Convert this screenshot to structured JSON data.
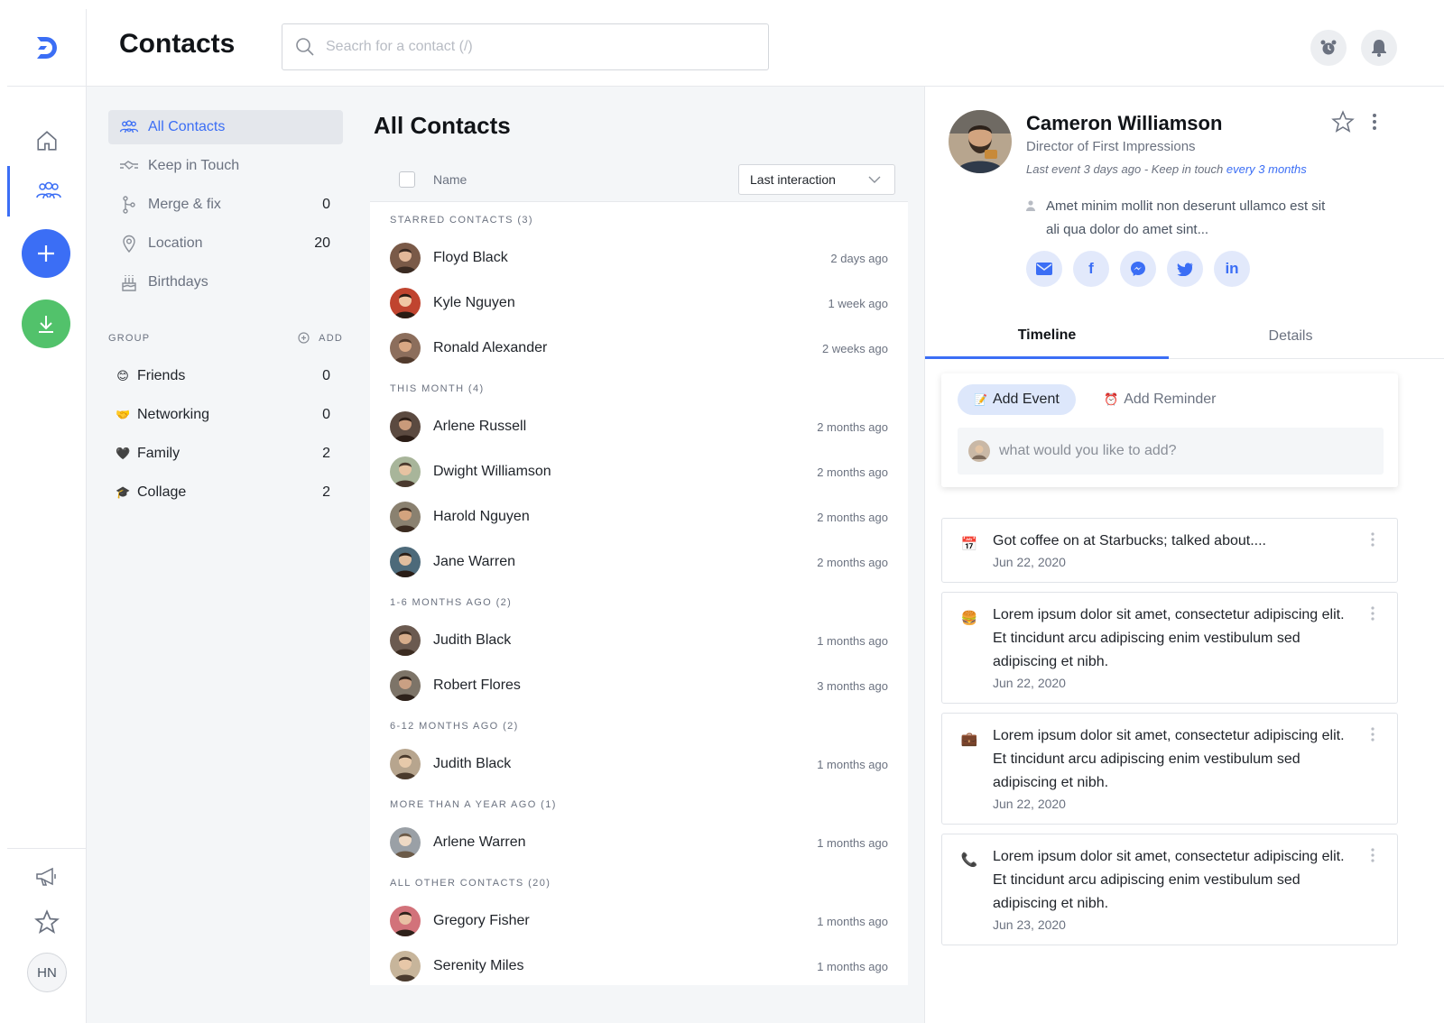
{
  "app": {
    "page_title": "Contacts",
    "brand_color": "#3b6ef5"
  },
  "search": {
    "placeholder": "Seacrh for a contact (/)"
  },
  "rail": {
    "user_initials": "HN"
  },
  "filters": [
    {
      "label": "All Contacts",
      "count": "",
      "icon": "people-icon"
    },
    {
      "label": "Keep in Touch",
      "count": "",
      "icon": "handshake-icon"
    },
    {
      "label": "Merge & fix",
      "count": "0",
      "icon": "merge-icon"
    },
    {
      "label": "Location",
      "count": "20",
      "icon": "location-pin-icon"
    },
    {
      "label": "Birthdays",
      "count": "",
      "icon": "cake-icon"
    }
  ],
  "groups": {
    "header": "GROUP",
    "add_label": "ADD",
    "items": [
      {
        "emoji": "😊",
        "label": "Friends",
        "count": "0"
      },
      {
        "emoji": "🤝",
        "label": "Networking",
        "count": "0"
      },
      {
        "emoji": "🖤",
        "label": "Family",
        "count": "2"
      },
      {
        "emoji": "🎓",
        "label": "Collage",
        "count": "2"
      }
    ]
  },
  "list": {
    "title": "All Contacts",
    "name_header": "Name",
    "sort_label": "Last interaction",
    "sections": [
      {
        "label": "STARRED CONTACTS (3)",
        "rows": [
          {
            "name": "Floyd Black",
            "time": "2 days ago"
          },
          {
            "name": "Kyle Nguyen",
            "time": "1 week ago"
          },
          {
            "name": "Ronald Alexander",
            "time": "2 weeks ago"
          }
        ]
      },
      {
        "label": "THIS MONTH (4)",
        "rows": [
          {
            "name": "Arlene Russell",
            "time": "2 months ago"
          },
          {
            "name": "Dwight Williamson",
            "time": "2 months ago"
          },
          {
            "name": "Harold Nguyen",
            "time": "2 months ago"
          },
          {
            "name": "Jane Warren",
            "time": "2 months ago"
          }
        ]
      },
      {
        "label": "1-6 MONTHS AGO (2)",
        "rows": [
          {
            "name": "Judith Black",
            "time": "1 months ago"
          },
          {
            "name": "Robert Flores",
            "time": "3 months ago"
          }
        ]
      },
      {
        "label": "6-12 MONTHS AGO (2)",
        "rows": [
          {
            "name": "Judith Black",
            "time": "1 months ago"
          }
        ]
      },
      {
        "label": "MORE THAN A YEAR AGO (1)",
        "rows": [
          {
            "name": "Arlene Warren",
            "time": "1 months ago"
          }
        ]
      },
      {
        "label": "ALL OTHER CONTACTS (20)",
        "rows": [
          {
            "name": "Gregory Fisher",
            "time": "1 months ago"
          },
          {
            "name": "Serenity Miles",
            "time": "1 months ago"
          }
        ]
      }
    ]
  },
  "detail": {
    "name": "Cameron Williamson",
    "role": "Director of First Impressions",
    "meta_prefix": "Last event 3 days ago - Keep in touch ",
    "meta_highlight": "every 3 months",
    "note": "Amet minim mollit non deserunt ullamco est sit ali qua dolor do amet sint...",
    "socials": [
      "mail-icon",
      "facebook-icon",
      "messenger-icon",
      "twitter-icon",
      "linkedin-icon"
    ],
    "tabs": {
      "timeline": "Timeline",
      "details": "Details"
    },
    "composer": {
      "add_event": "Add Event",
      "add_reminder": "Add Reminder",
      "placeholder": "what would you like to add?"
    },
    "events": [
      {
        "icon": "📅",
        "text": "Got coffee on at Starbucks; talked about....",
        "date": "Jun  22, 2020"
      },
      {
        "icon": "🍔",
        "text": "Lorem ipsum dolor sit amet, consectetur adipiscing elit. Et tincidunt arcu adipiscing enim vestibulum sed adipiscing et nibh.",
        "date": "Jun  22, 2020"
      },
      {
        "icon": "💼",
        "text": "Lorem ipsum dolor sit amet, consectetur adipiscing elit. Et tincidunt arcu adipiscing enim vestibulum sed adipiscing et nibh.",
        "date": "Jun  22, 2020"
      },
      {
        "icon": "📞",
        "text": "Lorem ipsum dolor sit amet, consectetur adipiscing elit. Et tincidunt arcu adipiscing enim vestibulum sed adipiscing et nibh.",
        "date": "Jun  23, 2020"
      }
    ]
  }
}
